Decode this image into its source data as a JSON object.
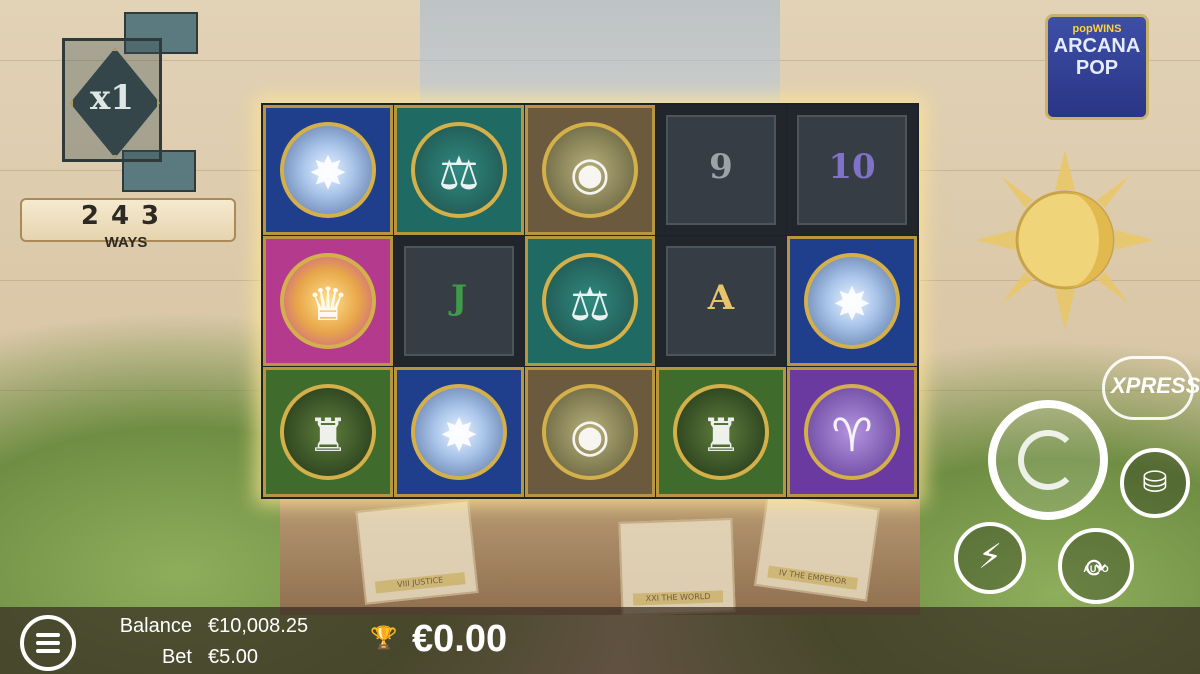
{
  "game": {
    "logo_brand": "popWINS",
    "logo_line1": "ARCANA",
    "logo_line2": "POP"
  },
  "multiplier": {
    "value": "x1"
  },
  "ways": {
    "count": "243",
    "label": "WAYS"
  },
  "reels": {
    "grid": [
      [
        "star",
        "libra",
        "world",
        "9",
        "10"
      ],
      [
        "princess",
        "J",
        "libra",
        "A",
        "star"
      ],
      [
        "tower",
        "star",
        "world",
        "tower",
        "devil"
      ]
    ],
    "low_symbol_colors": {
      "9": "#9aa3a8",
      "10": "#7f73c9",
      "J": "#3f9a4a",
      "A": "#e6c46a"
    }
  },
  "tarot_cards": [
    "VIII JUSTICE",
    "XXI THE WORLD",
    "IV THE EMPEROR"
  ],
  "controls": {
    "xpress_label": "XPRESS",
    "auto_label": "AUTO",
    "spin_icon": "spin-icon",
    "bet_icon": "coin-stack-icon",
    "turbo_icon": "lightning-icon"
  },
  "footer": {
    "balance_label": "Balance",
    "balance_value": "€10,008.25",
    "bet_label": "Bet",
    "bet_value": "€5.00",
    "win_value": "€0.00"
  }
}
